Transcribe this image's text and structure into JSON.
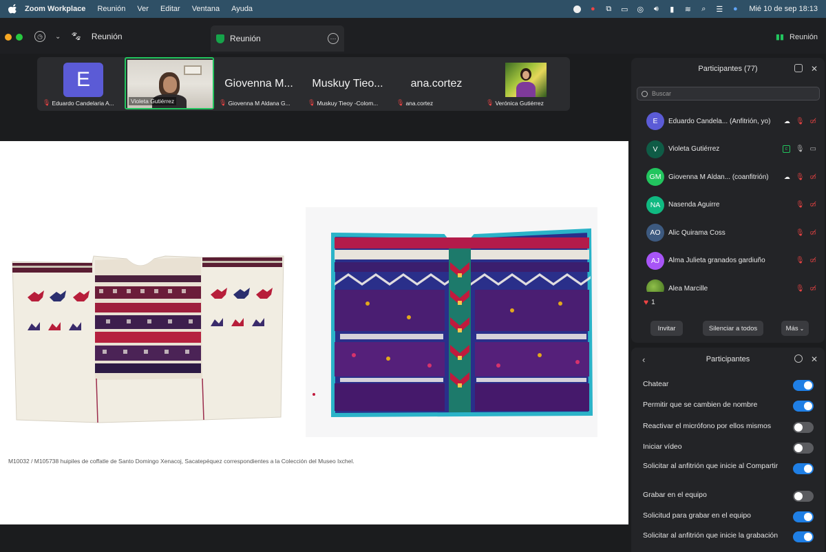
{
  "menubar": {
    "items": [
      "Zoom Workplace",
      "Reunión",
      "Ver",
      "Editar",
      "Ventana",
      "Ayuda"
    ],
    "clock": "Mié 10 de sep 18:13"
  },
  "titlebar": {
    "meeting_label": "Reunión",
    "tab_title": "Reunión",
    "right_label": "Reunión"
  },
  "strip": {
    "thumbs": [
      {
        "initial": "E",
        "caption": "Eduardo Candelaria A..."
      },
      {
        "caption": "Violeta Gutiérrez"
      },
      {
        "big": "Giovenna M...",
        "caption": "Giovenna M Aldana G..."
      },
      {
        "big": "Muskuy Tieo...",
        "caption": "Muskuy Tieoy -Colom..."
      },
      {
        "big": "ana.cortez",
        "caption": "ana.cortez"
      },
      {
        "caption": "Verónica Gutiérrez"
      }
    ]
  },
  "slide": {
    "caption": "M10032 / M105738 huipiles de coffatle de Santo Domingo Xenacoj, Sacatepéquez correspondientes a la Colección del Museo Ixchel."
  },
  "participants": {
    "title": "Participantes (77)",
    "search_placeholder": "Buscar",
    "list": [
      {
        "initials": "E",
        "color": "#5b5bd6",
        "name": "Eduardo Candela... (Anfitrión, yo)"
      },
      {
        "initials": "V",
        "color": "#0f5c46",
        "name": "Violeta Gutiérrez"
      },
      {
        "initials": "GM",
        "color": "#22c55e",
        "name": "Giovenna M Aldan... (coanfitrión)"
      },
      {
        "initials": "NA",
        "color": "#10b981",
        "name": "Nasenda Aguirre"
      },
      {
        "initials": "AO",
        "color": "#3d5a80",
        "name": "Alic Quirama Coss"
      },
      {
        "initials": "AJ",
        "color": "#a855f7",
        "name": "Alma Julieta granados gardiuño"
      },
      {
        "initials": "",
        "color": "#4d7c0f",
        "name": "Alea Marcille"
      }
    ],
    "reaction_count": "1",
    "buttons": [
      "Invitar",
      "Silenciar a todos",
      "Más"
    ]
  },
  "settings": {
    "title": "Participantes",
    "toggles": [
      {
        "label": "Chatear",
        "on": true
      },
      {
        "label": "Permitir que se cambien de nombre",
        "on": true
      },
      {
        "label": "Reactivar el micrófono por ellos mismos",
        "on": false
      },
      {
        "label": "Iniciar vídeo",
        "on": false
      },
      {
        "label": "Solicitar al anfitrión que inicie al Compartir",
        "on": true
      },
      {
        "label": "Grabar en el equipo",
        "on": false
      },
      {
        "label": "Solicitud para grabar en el equipo",
        "on": true
      },
      {
        "label": "Solicitar al anfitrión que inicie la grabación",
        "on": true
      }
    ]
  },
  "colors": {
    "menubar": "#2f5066",
    "accent_green": "#22c55e",
    "toggle_on": "#1f7fe5",
    "muted_red": "#ef4444"
  }
}
